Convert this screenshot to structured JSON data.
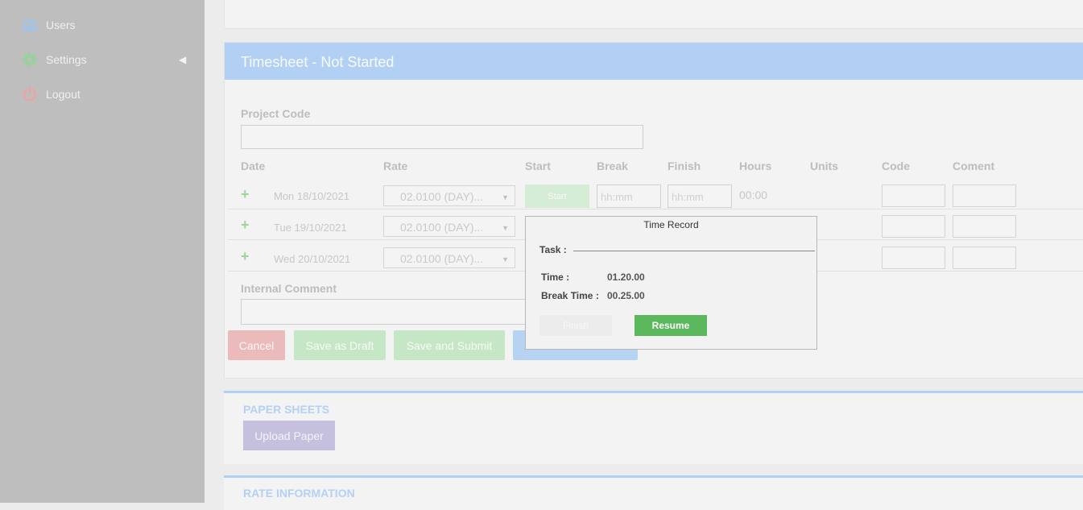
{
  "sidebar": {
    "items": [
      {
        "label": "Users",
        "icon": "users-icon"
      },
      {
        "label": "Settings",
        "icon": "gear-icon"
      },
      {
        "label": "Logout",
        "icon": "power-icon"
      }
    ]
  },
  "timesheet": {
    "title": "Timesheet - Not Started",
    "project_code_label": "Project Code",
    "columns": [
      "Date",
      "Rate",
      "Start",
      "Break",
      "Finish",
      "Hours",
      "Units",
      "Code",
      "Coment"
    ],
    "rows": [
      {
        "date": "Mon 18/10/2021",
        "rate": "02.0100 (DAY)..."
      },
      {
        "date": "Tue 19/10/2021",
        "rate": "02.0100 (DAY)..."
      },
      {
        "date": "Wed 20/10/2021",
        "rate": "02.0100 (DAY)..."
      }
    ],
    "start_label": "Start",
    "time_placeholder": "hh:mm",
    "hours_value": "00:00",
    "internal_comment_label": "Internal Comment",
    "buttons": {
      "cancel": "Cancel",
      "save_draft": "Save as Draft",
      "save_submit": "Save and Submit"
    }
  },
  "paper_sheets": {
    "title": "PAPER SHEETS",
    "upload_label": "Upload Paper"
  },
  "rate_info": {
    "title": "RATE INFORMATION"
  },
  "modal": {
    "title": "Time Record",
    "task_label": "Task :",
    "time_label": "Time :",
    "time_value": "01.20.00",
    "break_label": "Break Time :",
    "break_value": "00.25.00",
    "finish_label": "Finish",
    "resume_label": "Resume"
  },
  "colors": {
    "header_blue": "#b2d0f3",
    "resume_green": "#5cb85c",
    "cancel_red": "#ebbaba",
    "save_green": "#c5e7c5",
    "upload_purple": "#c4c0dd"
  }
}
